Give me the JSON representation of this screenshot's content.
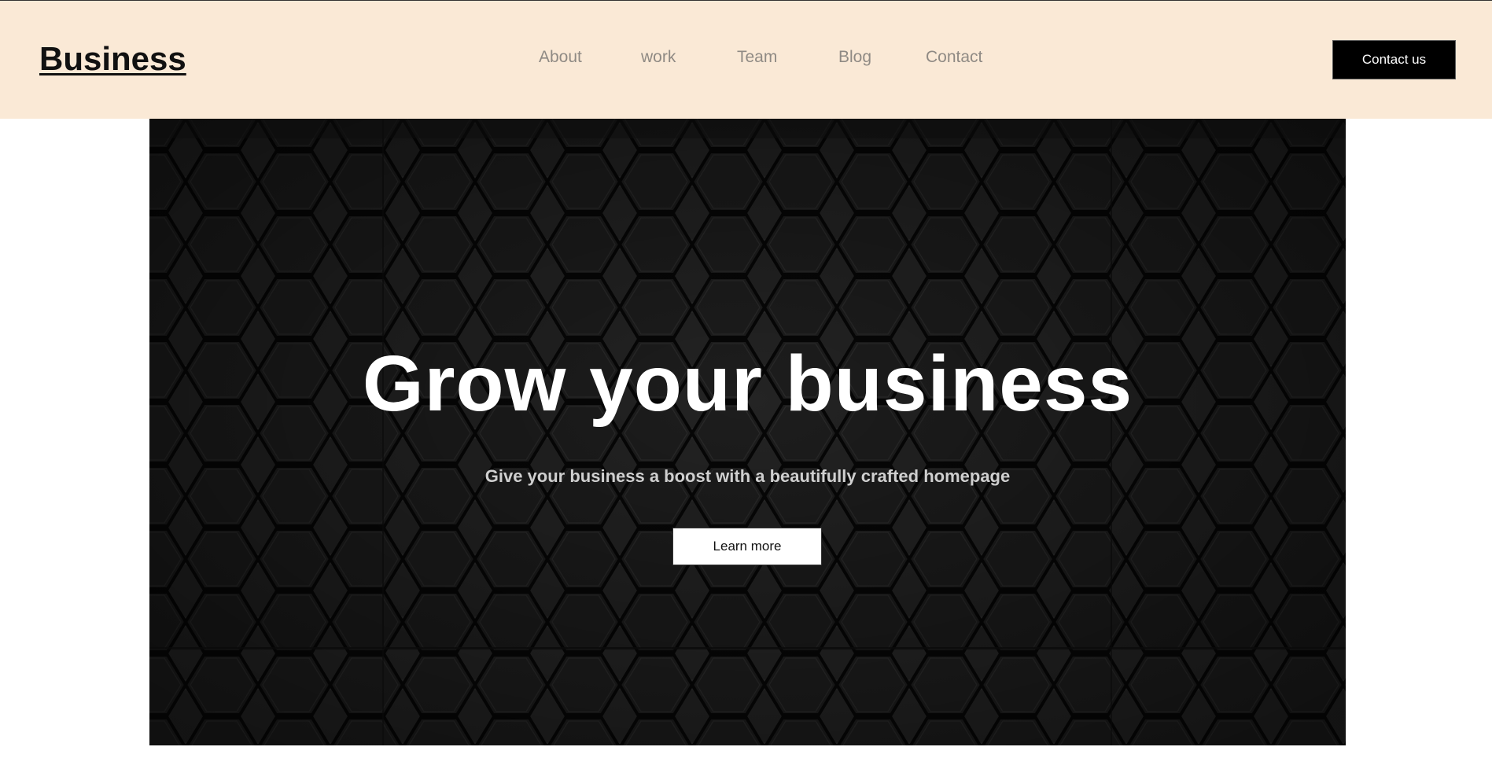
{
  "header": {
    "logo": "Business",
    "nav": [
      "About",
      "work",
      "Team",
      "Blog",
      "Contact"
    ],
    "cta_label": "Contact us",
    "background": "#fae9d6"
  },
  "hero": {
    "title": "Grow your business",
    "subtitle": "Give your business a boost with a beautifully crafted homepage",
    "button_label": "Learn more",
    "background_pattern": "dark-hexagon-tiles"
  }
}
